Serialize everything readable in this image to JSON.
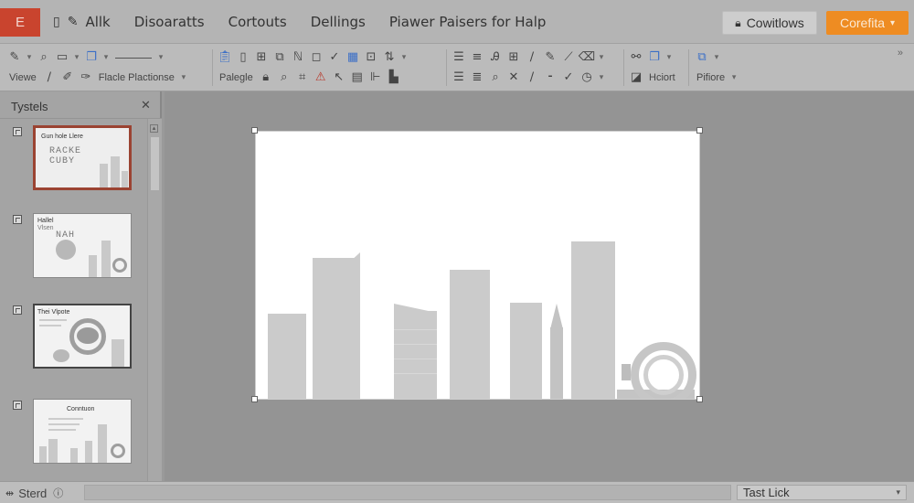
{
  "app": {
    "badge": "E"
  },
  "menu": [
    {
      "icon": "▯",
      "label": "Allk"
    },
    {
      "label": "Disoaratts"
    },
    {
      "label": "Cortouts"
    },
    {
      "label": "Dellings"
    },
    {
      "label": "Piawer Paisers for Halp"
    }
  ],
  "header_buttons": {
    "secondary_label": "Cowitlows",
    "primary_label": "Corefita"
  },
  "ribbon": {
    "view_label": "Viewe",
    "placeholder_label": "Flacle Plactionse",
    "paste_label": "Palegle",
    "insert_label": "Hciort",
    "picture_label": "Pifiore"
  },
  "slides_panel": {
    "title": "Tystels",
    "thumbs": [
      {
        "title": "Gun hole Llere",
        "big_text": "RACKE\nCUBY"
      },
      {
        "title": "Hallel",
        "subtitle": "Vlsen",
        "big_text": "NAH"
      },
      {
        "title": "Thei Vlpote"
      },
      {
        "title": "Conntuon"
      }
    ]
  },
  "status": {
    "left_label": "Sterd",
    "zoom_label": "Tast Lick"
  },
  "colors": {
    "accent_orange": "#ee8c22",
    "app_red": "#c9442e",
    "selected_border": "#9b4332"
  }
}
